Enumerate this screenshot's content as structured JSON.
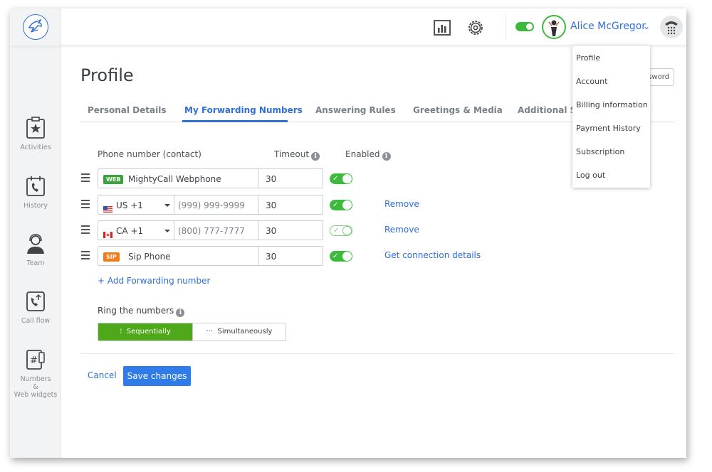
{
  "header": {
    "user_name": "Alice McGregor",
    "status_enabled": true,
    "icons": [
      "logo-icon",
      "stats-icon",
      "settings-icon",
      "avatar",
      "dialpad-icon"
    ]
  },
  "user_menu": {
    "items": [
      "Profile",
      "Account",
      "Billing information",
      "Payment History",
      "Subscription",
      "Log out"
    ]
  },
  "sidebar": {
    "items": [
      {
        "label": "Activities",
        "icon": "star-clipboard-icon"
      },
      {
        "label": "History",
        "icon": "calendar-phone-icon"
      },
      {
        "label": "Team",
        "icon": "headset-person-icon"
      },
      {
        "label": "Call flow",
        "icon": "call-flow-icon"
      },
      {
        "label": "Numbers\n&\nWeb widgets",
        "icon": "hash-phone-icon"
      }
    ]
  },
  "page": {
    "title": "Profile",
    "password_button": "ssword"
  },
  "tabs": [
    {
      "label": "Personal Details",
      "active": false
    },
    {
      "label": "My Forwarding Numbers",
      "active": true
    },
    {
      "label": "Answering Rules",
      "active": false
    },
    {
      "label": "Greetings & Media",
      "active": false
    },
    {
      "label": "Additional Se",
      "active": false
    }
  ],
  "table": {
    "col_phone": "Phone number (contact)",
    "col_timeout": "Timeout",
    "col_enabled": "Enabled"
  },
  "rows": [
    {
      "type": "web",
      "badge": "WEB",
      "name": "MightyCall Webphone",
      "timeout": "30",
      "enabled": "on",
      "link": ""
    },
    {
      "type": "phone",
      "country": "US +1",
      "flag": "us",
      "placeholder": "(999) 999-9999",
      "timeout": "30",
      "enabled": "on",
      "link": "Remove"
    },
    {
      "type": "phone",
      "country": "CA +1",
      "flag": "ca",
      "placeholder": "(800) 777-7777",
      "timeout": "30",
      "enabled": "pending",
      "link": "Remove"
    },
    {
      "type": "sip",
      "badge": "SIP",
      "name": "Sip Phone",
      "timeout": "30",
      "enabled": "on",
      "link": "Get connection details"
    }
  ],
  "add_forwarding": "+ Add Forwarding number",
  "ring": {
    "label": "Ring the numbers",
    "options": [
      "Sequentially",
      "Simultaneously"
    ],
    "selected": "Sequentially"
  },
  "actions": {
    "cancel": "Cancel",
    "save": "Save changes"
  },
  "colors": {
    "accent": "#2f6fd6",
    "toggle_on": "#3cba3c",
    "segment_active": "#4fa819",
    "sip_badge": "#f07d1b",
    "web_badge": "#3ba53b"
  }
}
